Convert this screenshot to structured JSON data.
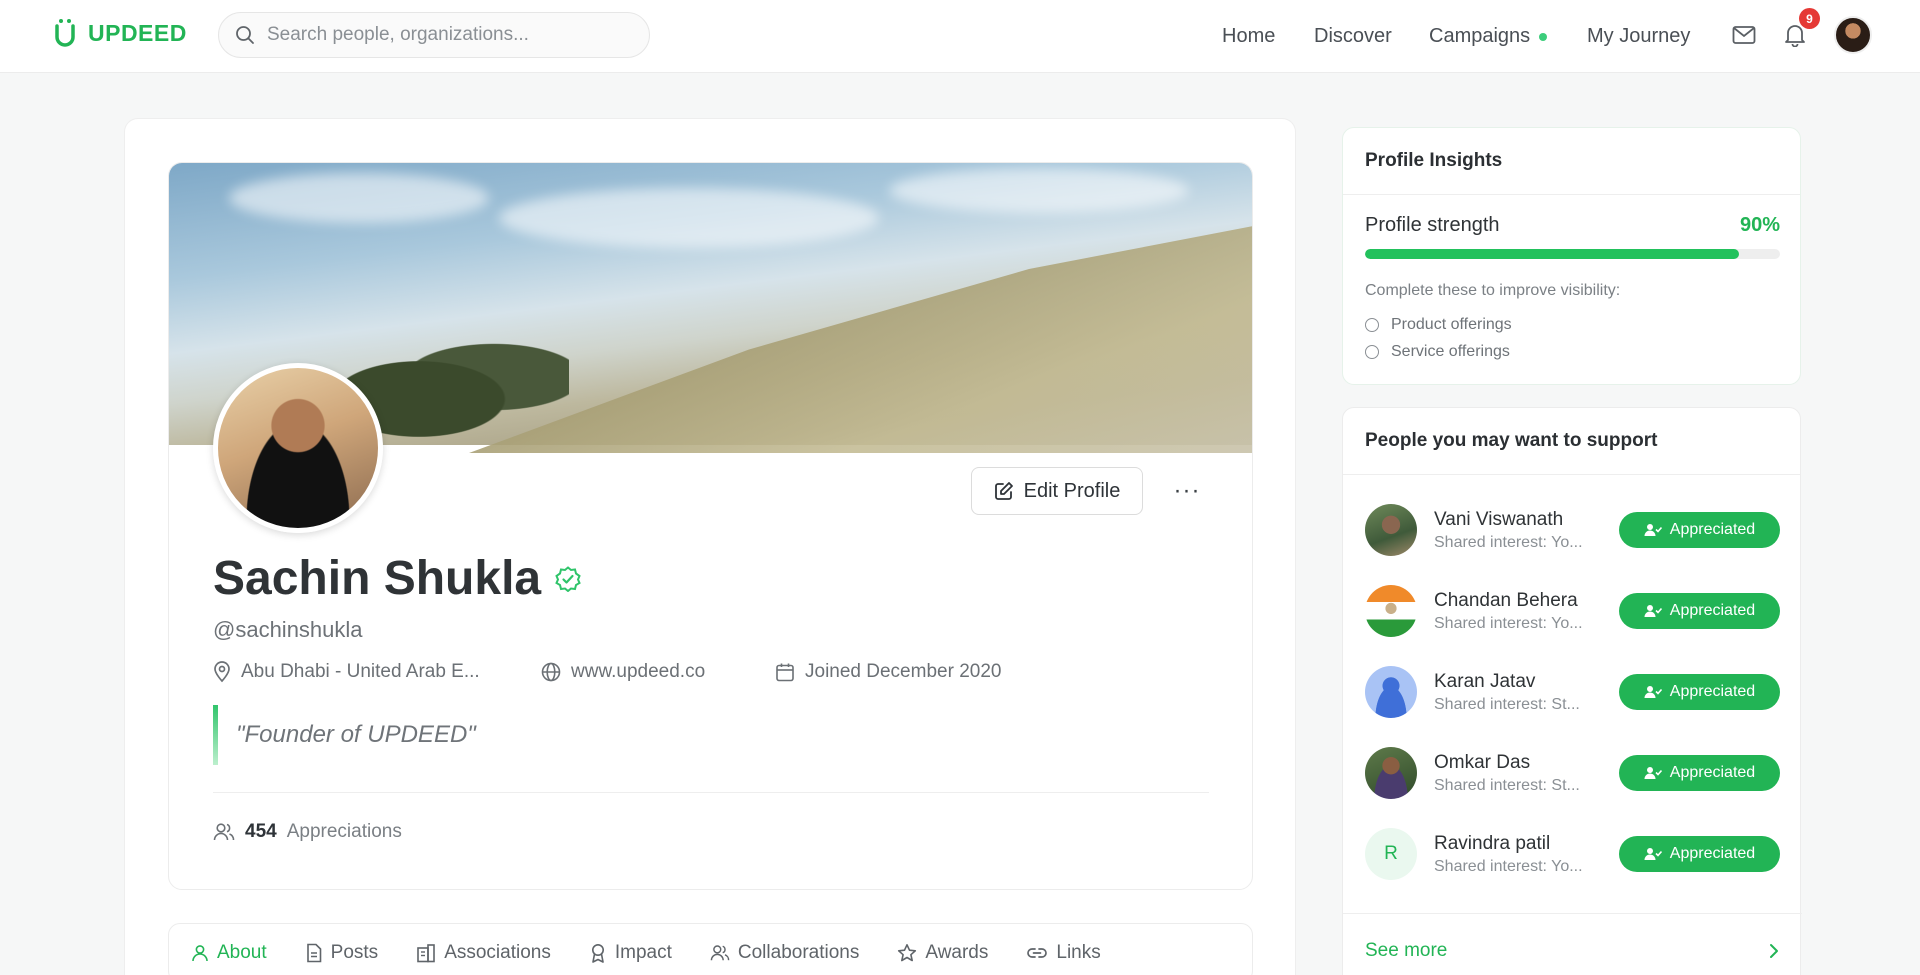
{
  "app": {
    "brand": "UPDEED",
    "brand_color": "#22b455"
  },
  "search": {
    "placeholder": "Search people, organizations..."
  },
  "nav": {
    "home": "Home",
    "discover": "Discover",
    "campaigns": "Campaigns",
    "journey": "My Journey",
    "notification_count": "9"
  },
  "profile": {
    "name": "Sachin Shukla",
    "handle": "@sachinshukla",
    "location": "Abu Dhabi - United Arab E...",
    "website": "www.updeed.co",
    "joined": "Joined December 2020",
    "quote": "\"Founder of UPDEED\"",
    "edit_label": "Edit Profile",
    "more_label": "···",
    "appreciation_count": "454",
    "appreciation_label": "Appreciations"
  },
  "tabs": [
    "About",
    "Posts",
    "Associations",
    "Impact",
    "Collaborations",
    "Awards",
    "Links"
  ],
  "insights": {
    "title": "Profile Insights",
    "strength_label": "Profile strength",
    "strength_pct": "90%",
    "strength_value": 0.9,
    "improve_label": "Complete these to improve visibility:",
    "items": [
      "Product offerings",
      "Service offerings"
    ]
  },
  "support": {
    "title": "People you may want to support",
    "button_label": "Appreciated",
    "see_more": "See more",
    "people": [
      {
        "name": "Vani Viswanath",
        "sub": "Shared interest: Yo..."
      },
      {
        "name": "Chandan Behera",
        "sub": "Shared interest: Yo..."
      },
      {
        "name": "Karan Jatav",
        "sub": "Shared interest: St..."
      },
      {
        "name": "Omkar Das",
        "sub": "Shared interest: St..."
      },
      {
        "name": "Ravindra patil",
        "sub": "Shared interest: Yo...",
        "initial": "R"
      }
    ]
  }
}
